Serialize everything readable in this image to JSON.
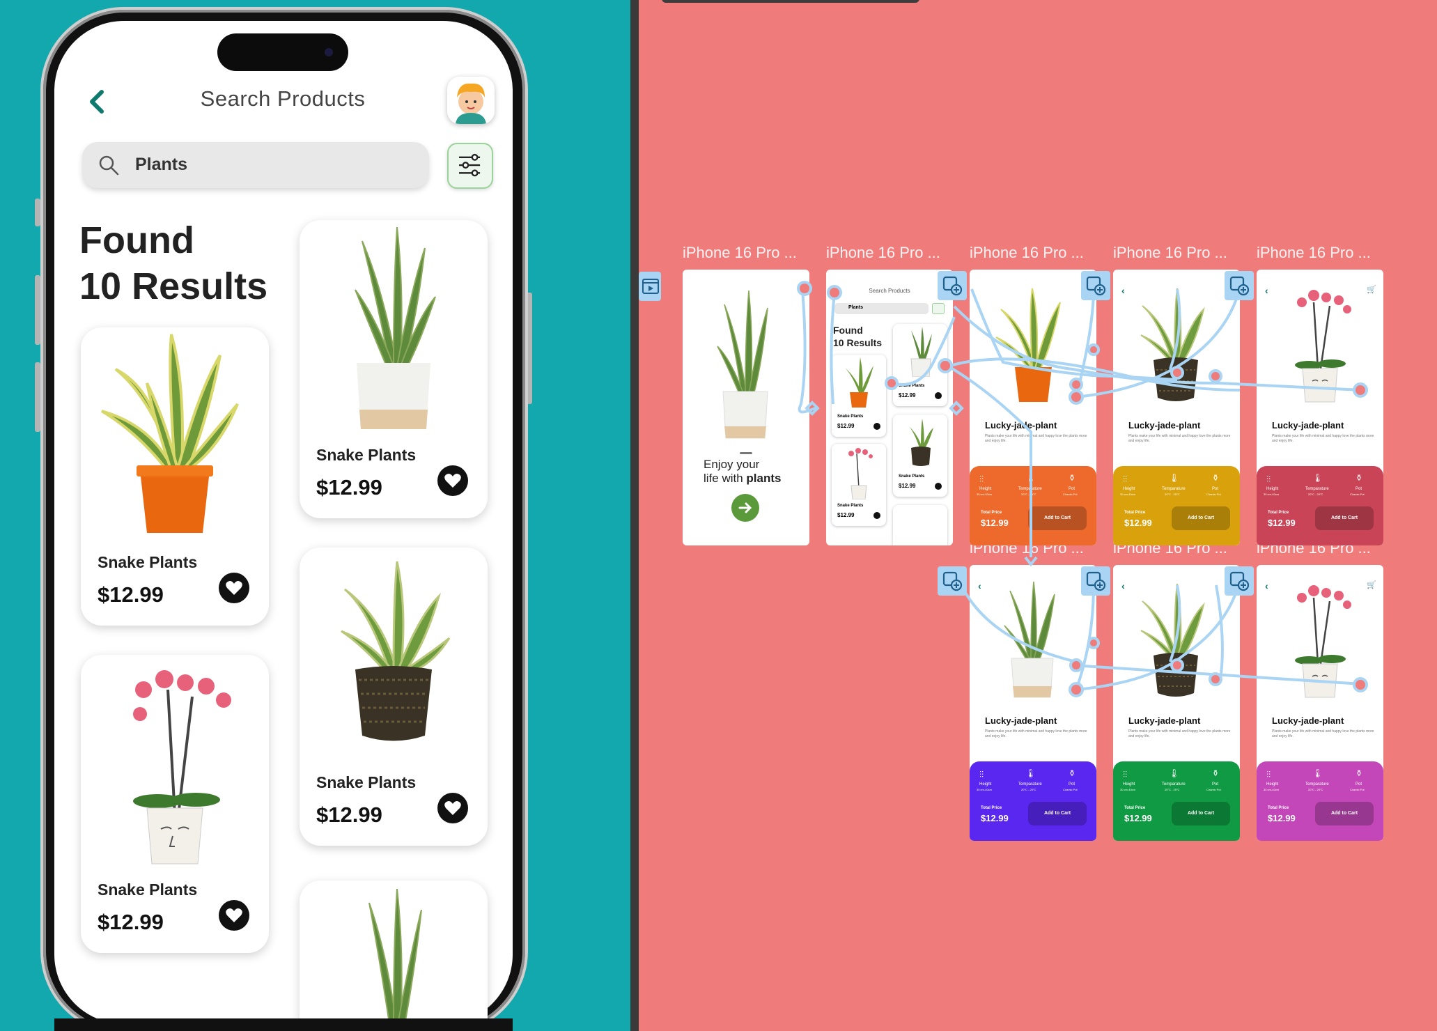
{
  "app": {
    "header_title": "Search Products",
    "search": {
      "value": "Plants"
    },
    "results_heading_line1": "Found",
    "results_heading_line2": "10 Results",
    "products": [
      {
        "name": "Snake Plants",
        "price": "$12.99",
        "image": "snake-plant-orange-pot"
      },
      {
        "name": "Snake Plants",
        "price": "$12.99",
        "image": "snake-plant-white-pot"
      },
      {
        "name": "Snake Plants",
        "price": "$12.99",
        "image": "orchid-face-pot"
      },
      {
        "name": "Snake Plants",
        "price": "$12.99",
        "image": "snake-plant-dark-pot"
      },
      {
        "name": "",
        "price": "",
        "image": "snake-plant-white-pot"
      }
    ],
    "colors": {
      "accent": "#0e7a6e",
      "background": "#13a8ad",
      "canvas": "#ef7b7b"
    }
  },
  "canvas": {
    "frame_label": "iPhone 16 Pro ...",
    "onboarding": {
      "line1": "Enjoy your",
      "line2_prefix": "life with ",
      "line2_bold": "plants"
    },
    "mini_search": {
      "title": "Search Products",
      "value": "Plants",
      "found": "Found",
      "results": "10 Results"
    },
    "detail": {
      "title": "Lucky-jade-plant",
      "desc": "Plants make your life with minimal and happy love the plants more and enjoy life.",
      "spec_height": "Height",
      "spec_height_val": "30 cm-40cm",
      "spec_temp": "Temparature",
      "spec_temp_val": "20°C - 25°C",
      "spec_pot": "Pot",
      "spec_pot_val": "Ciramic Pot",
      "total_label": "Total Price",
      "price": "$12.99",
      "cta": "Add to Cart"
    },
    "detail_colors": [
      "#ee6a2c",
      "#d9a20c",
      "#c94456",
      "#5a27f0",
      "#0f9a43",
      "#c347b8"
    ],
    "mini_prices": [
      "$12.99",
      "$12.99",
      "$12.99",
      "$12.99"
    ],
    "mini_names": [
      "Snake Plants",
      "Snake Plants",
      "Snake Plants",
      "Snake Plants"
    ]
  }
}
